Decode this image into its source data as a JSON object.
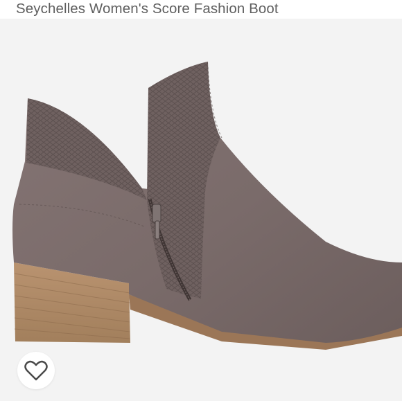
{
  "listing": {
    "title": "Seychelles Women's Score Fashion Boot"
  },
  "image": {
    "subject": "taupe suede ankle boot with snake-embossed side panel, side zipper and stacked wooden block heel"
  },
  "actions": {
    "like_icon": "heart-outline-icon"
  },
  "colors": {
    "title_text": "#5f5f5f",
    "image_background": "#f3f3f3",
    "suede": "#7a6b6a",
    "heel": "#b08a63",
    "heart_outline": "#4a4a4a"
  }
}
